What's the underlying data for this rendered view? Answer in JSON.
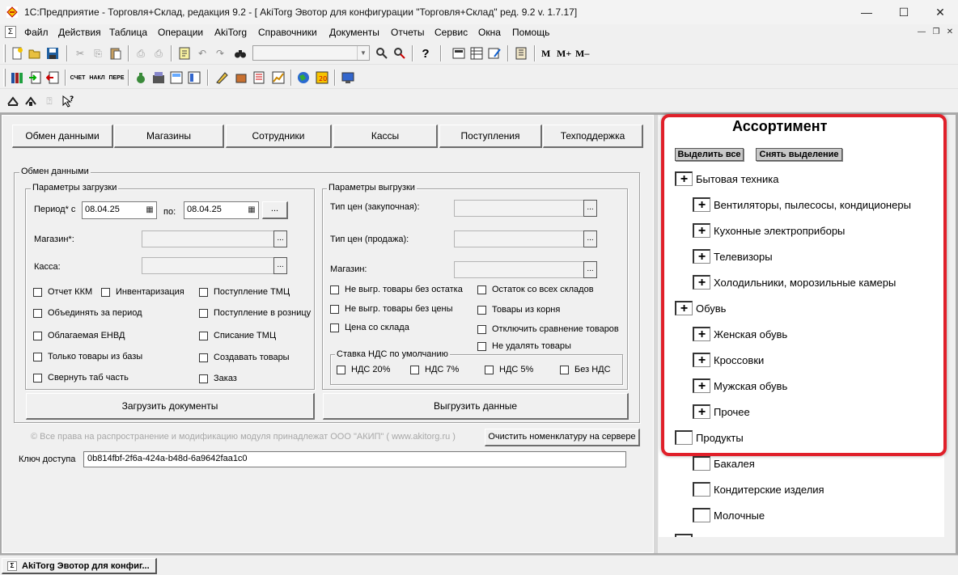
{
  "window": {
    "title": "1С:Предприятие - Торговля+Склад, редакция 9.2 - [ AkiTorg Эвотор для конфигурации \"Торговля+Склад\" ред. 9.2 v. 1.7.17]",
    "minimize": "—",
    "maximize": "☐",
    "close": "✕"
  },
  "menu": [
    "Файл",
    "Действия",
    "Таблица",
    "Операции",
    "AkiTorg",
    "Справочники",
    "Документы",
    "Отчеты",
    "Сервис",
    "Окна",
    "Помощь"
  ],
  "toolbar3": {
    "m": "M",
    "mplus": "M+",
    "mminus": "M–"
  },
  "tabs": [
    "Обмен данными",
    "Магазины",
    "Сотрудники",
    "Кассы",
    "Поступления",
    "Техподдержка"
  ],
  "exchange": {
    "group_title": "Обмен данными",
    "load": {
      "title": "Параметры загрузки",
      "period_label": "Период* с",
      "date_from": "08.04.25",
      "to_label": "по:",
      "date_to": "08.04.25",
      "dots": "...",
      "shop_label": "Магазин*:",
      "cash_label": "Касса:",
      "checks_col1": [
        "Отчет ККМ",
        "Объединять за период",
        "Облагаемая ЕНВД",
        "Только товары из базы",
        "Свернуть таб часть"
      ],
      "checks_col2": [
        "Инвентаризация"
      ],
      "checks_col3": [
        "Поступление ТМЦ",
        "Поступление в розницу",
        "Списание ТМЦ",
        "Создавать товары",
        "Заказ"
      ],
      "button": "Загрузить документы"
    },
    "unload": {
      "title": "Параметры выгрузки",
      "price_buy_label": "Тип цен (закупочная):",
      "price_sell_label": "Тип цен (продажа):",
      "shop_label": "Магазин:",
      "checks_col1": [
        "Не выгр. товары без остатка",
        "Не выгр. товары без цены",
        "Цена со склада"
      ],
      "checks_col2": [
        "Остаток со всех складов",
        "Товары из корня",
        "Отключить сравнение товаров",
        "Не удалять товары"
      ],
      "vat_title": "Ставка НДС по умолчанию",
      "vat": [
        "НДС 20%",
        "НДС 7%",
        "НДС 5%",
        "Без НДС"
      ],
      "button": "Выгрузить данные"
    },
    "copyright": "© Все права на распространение и модификацию модуля принадлежат ООО \"АКИП\" ( www.akitorg.ru )",
    "clear_button": "Очистить номенклатуру на сервере",
    "key_label": "Ключ доступа",
    "key_value": "0b814fbf-2f6a-424a-b48d-6a9642faa1c0"
  },
  "assortment": {
    "title": "Ассортимент",
    "select_all": "Выделить все",
    "deselect": "Снять выделение",
    "items": [
      {
        "label": "Бытовая техника",
        "sign": "+"
      },
      {
        "label": "Вентиляторы, пылесосы, кондиционеры",
        "sign": "+"
      },
      {
        "label": "Кухонные электроприборы",
        "sign": "+"
      },
      {
        "label": "Телевизоры",
        "sign": "+"
      },
      {
        "label": "Холодильники, морозильные камеры",
        "sign": "+"
      },
      {
        "label": "Обувь",
        "sign": "+"
      },
      {
        "label": "Женская обувь",
        "sign": "+"
      },
      {
        "label": "Кроссовки",
        "sign": "+"
      },
      {
        "label": "Мужская обувь",
        "sign": "+"
      },
      {
        "label": "Прочее",
        "sign": "+"
      },
      {
        "label": "Продукты",
        "sign": ""
      },
      {
        "label": "Бакалея",
        "sign": ""
      },
      {
        "label": "Кондитерские изделия",
        "sign": ""
      },
      {
        "label": "Молочные",
        "sign": ""
      }
    ]
  },
  "taskbar": {
    "item": "AkiTorg Эвотор для конфиг..."
  },
  "colors": {
    "highlight": "#e0202a",
    "workspace": "#a9a9a9"
  }
}
